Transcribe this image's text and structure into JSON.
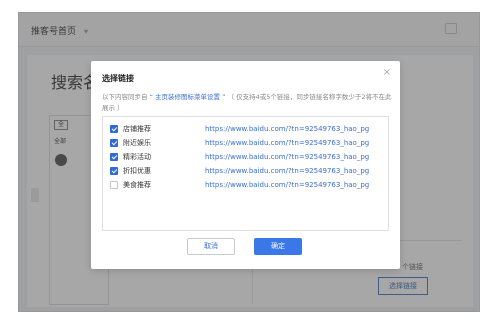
{
  "background": {
    "nav_label": "推客号首页",
    "page_title": "搜索名",
    "tag_label": "全",
    "all_label": "全部",
    "link_label": "个链接",
    "link_button": "选择链接"
  },
  "dialog": {
    "title": "选择链接",
    "close_glyph": "×",
    "desc_prefix": "以下内容同步自",
    "desc_highlight": "“ 主页装修图标菜单设置 ”",
    "desc_suffix": "（ 仅支持4或5个链接，同步链接名称字数少于2将不在此展示 ）",
    "items": [
      {
        "name": "店铺推荐",
        "url": "https://www.baidu.com/?tn=92549763_hao_pg",
        "checked": true
      },
      {
        "name": "附近娱乐",
        "url": "https://www.baidu.com/?tn=92549763_hao_pg",
        "checked": true
      },
      {
        "name": "精彩活动",
        "url": "https://www.baidu.com/?tn=92549763_hao_pg",
        "checked": true
      },
      {
        "name": "折扣优惠",
        "url": "https://www.baidu.com/?tn=92549763_hao_pg",
        "checked": true
      },
      {
        "name": "美食推荐",
        "url": "https://www.baidu.com/?tn=92549763_hao_pg",
        "checked": false
      }
    ],
    "cancel_label": "取消",
    "ok_label": "确定"
  },
  "colors": {
    "accent": "#3a78e8",
    "link": "#3a6fd0"
  }
}
